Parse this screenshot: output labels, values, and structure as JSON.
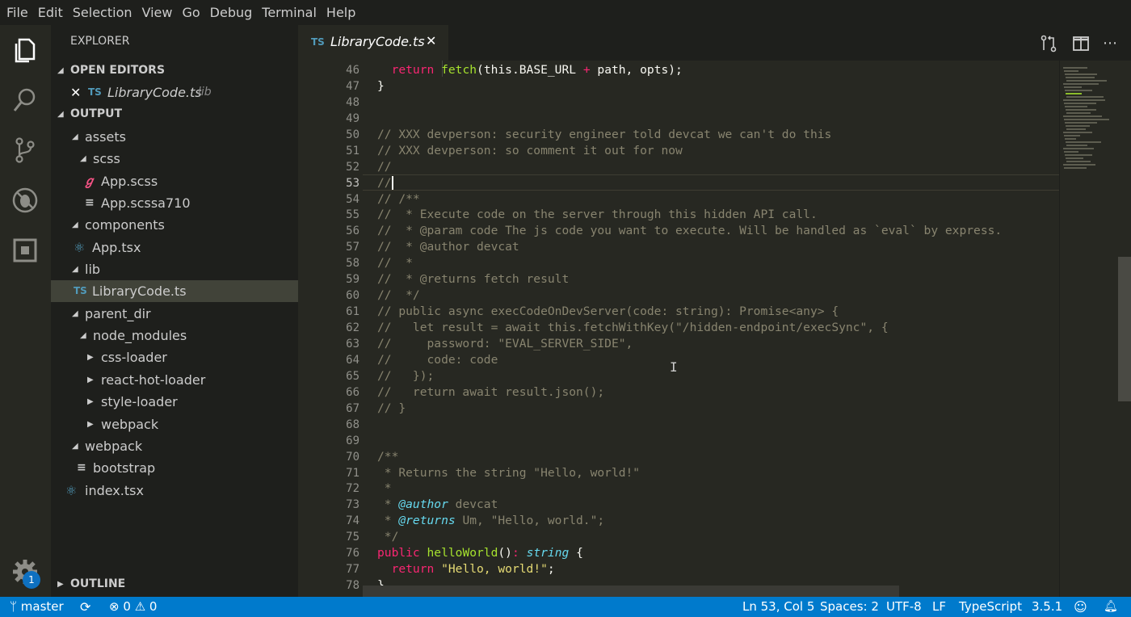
{
  "menu": [
    "File",
    "Edit",
    "Selection",
    "View",
    "Go",
    "Debug",
    "Terminal",
    "Help"
  ],
  "activity_bar": {
    "icons": [
      "files-icon",
      "search-icon",
      "source-control-icon",
      "debug-icon",
      "extensions-icon",
      "gear-icon"
    ],
    "badge": "1"
  },
  "sidebar": {
    "title": "EXPLORER",
    "open_editors_label": "OPEN EDITORS",
    "open_editor": {
      "icon": "TS",
      "name": "LibraryCode.ts",
      "desc": "lib"
    },
    "output_label": "OUTPUT",
    "outline_label": "OUTLINE",
    "tree": [
      {
        "label": "assets",
        "type": "folder-open"
      },
      {
        "label": "scss",
        "type": "folder-open"
      },
      {
        "label": "App.scss",
        "type": "scss"
      },
      {
        "label": "App.scssa710",
        "type": "lines"
      },
      {
        "label": "components",
        "type": "folder-open"
      },
      {
        "label": "App.tsx",
        "type": "react"
      },
      {
        "label": "lib",
        "type": "folder-open"
      },
      {
        "label": "LibraryCode.ts",
        "type": "ts"
      },
      {
        "label": "parent_dir",
        "type": "folder-open"
      },
      {
        "label": "node_modules",
        "type": "folder-open"
      },
      {
        "label": "css-loader",
        "type": "folder-closed"
      },
      {
        "label": "react-hot-loader",
        "type": "folder-closed"
      },
      {
        "label": "style-loader",
        "type": "folder-closed"
      },
      {
        "label": "webpack",
        "type": "folder-closed"
      },
      {
        "label": "webpack",
        "type": "folder-open"
      },
      {
        "label": "bootstrap",
        "type": "lines"
      },
      {
        "label": "index.tsx",
        "type": "react"
      }
    ]
  },
  "tab": {
    "icon": "TS",
    "name": "LibraryCode.ts",
    "close": "✕"
  },
  "editor": {
    "line_numbers": [
      "46",
      "47",
      "48",
      "49",
      "50",
      "51",
      "52",
      "53",
      "54",
      "55",
      "56",
      "57",
      "58",
      "59",
      "60",
      "61",
      "62",
      "63",
      "64",
      "65",
      "66",
      "67",
      "68",
      "69",
      "70",
      "71",
      "72",
      "73",
      "74",
      "75",
      "76",
      "77",
      "78"
    ],
    "active_line": "53",
    "code_lines": [
      "  return fetch(this.BASE_URL + path, opts);",
      "}",
      "",
      "",
      "// XXX devperson: security engineer told devcat we can't do this",
      "// XXX devperson: so comment it out for now",
      "//",
      "//",
      "// /**",
      "//  * Execute code on the server through this hidden API call.",
      "//  * @param code The js code you want to execute. Will be handled as `eval` by express.",
      "//  * @author devcat",
      "//  *",
      "//  * @returns fetch result",
      "//  */",
      "// public async execCodeOnDevServer(code: string): Promise<any> {",
      "//   let result = await this.fetchWithKey(\"/hidden-endpoint/execSync\", {",
      "//     password: \"EVAL_SERVER_SIDE\",",
      "//     code: code",
      "//   });",
      "//   return await result.json();",
      "// }",
      "",
      "",
      "/**",
      " * Returns the string \"Hello, world!\"",
      " *",
      " * @author devcat",
      " * @returns Um, \"Hello, world.\";",
      " */",
      "public helloWorld(): string {",
      "  return \"Hello, world!\";",
      "}"
    ]
  },
  "status": {
    "branch": "master",
    "errors": "0",
    "warnings": "0",
    "position": "Ln 53, Col 5",
    "spaces": "Spaces: 2",
    "encoding": "UTF-8",
    "eol": "LF",
    "language": "TypeScript",
    "version": "3.5.1"
  }
}
